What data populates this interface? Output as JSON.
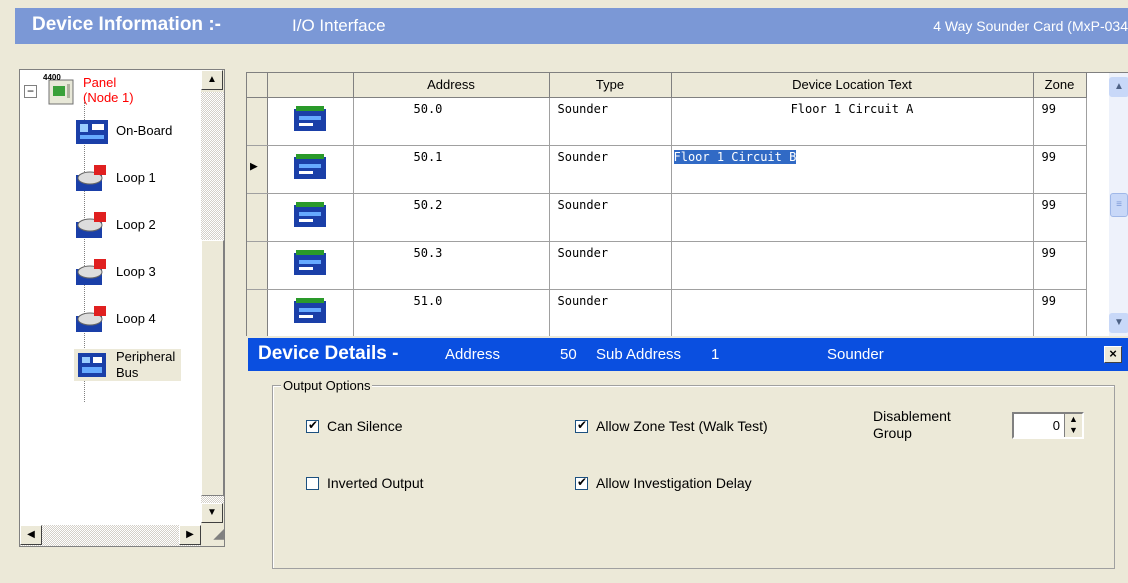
{
  "header": {
    "title": "Device Information :-",
    "subtitle": "I/O Interface",
    "card_type": "4 Way Sounder Card (MxP-034"
  },
  "tree": {
    "panel": {
      "badge": "4400",
      "line1": "Panel",
      "line2": "(Node 1)",
      "expander": "−"
    },
    "items": [
      {
        "label": "On-Board",
        "icon": "onboard-icon"
      },
      {
        "label": "Loop 1",
        "icon": "loop-icon"
      },
      {
        "label": "Loop 2",
        "icon": "loop-icon"
      },
      {
        "label": "Loop 3",
        "icon": "loop-icon"
      },
      {
        "label": "Loop 4",
        "icon": "loop-icon"
      },
      {
        "label_line1": "Peripheral",
        "label_line2": "Bus",
        "icon": "peripheral-bus-icon"
      }
    ]
  },
  "grid": {
    "columns": [
      "Address",
      "Type",
      "Device Location Text",
      "Zone"
    ],
    "rows": [
      {
        "address": "50.0",
        "type": "Sounder",
        "location": "Floor 1 Circuit A",
        "zone": "99",
        "current": false
      },
      {
        "address": "50.1",
        "type": "Sounder",
        "location": "Floor 1 Circuit B",
        "zone": "99",
        "current": true
      },
      {
        "address": "50.2",
        "type": "Sounder",
        "location": "",
        "zone": "99",
        "current": false
      },
      {
        "address": "50.3",
        "type": "Sounder",
        "location": "",
        "zone": "99",
        "current": false
      },
      {
        "address": "51.0",
        "type": "Sounder",
        "location": "",
        "zone": "99",
        "current": false
      }
    ]
  },
  "details": {
    "title": "Device Details -",
    "address_label": "Address",
    "address_value": "50",
    "sub_address_label": "Sub Address",
    "sub_address_value": "1",
    "device_type": "Sounder",
    "close": "×"
  },
  "output_options": {
    "legend": "Output Options",
    "can_silence": {
      "label": "Can Silence",
      "checked": true
    },
    "inverted_output": {
      "label": "Inverted Output",
      "checked": false
    },
    "allow_zone_test": {
      "label": "Allow Zone Test (Walk Test)",
      "checked": true
    },
    "allow_investigation_delay": {
      "label": "Allow Investigation Delay",
      "checked": true
    },
    "disablement_group": {
      "label_line1": "Disablement",
      "label_line2": "Group",
      "value": "0"
    }
  },
  "colors": {
    "header_bg": "#7b98d6",
    "details_bar_bg": "#0a4fe0",
    "selection_bg": "#316ac5",
    "panel_label": "#ff0000"
  }
}
